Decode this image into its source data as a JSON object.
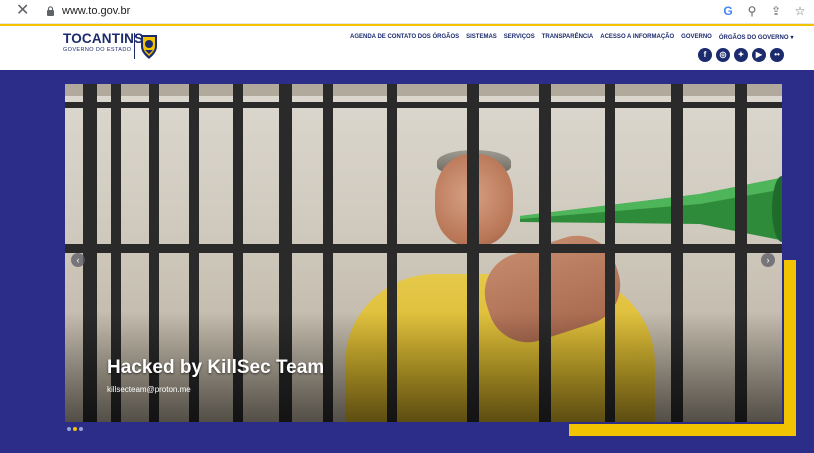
{
  "browser": {
    "url": "www.to.gov.br",
    "icons": [
      "close-icon",
      "lock-icon",
      "google-icon",
      "zoom-icon",
      "share-icon",
      "bookmark-star-icon"
    ]
  },
  "header": {
    "logo_name": "TOCANTINS",
    "logo_sub": "GOVERNO DO ESTADO",
    "nav": [
      "AGENDA DE CONTATO DOS ÓRGÃOS",
      "SISTEMAS",
      "SERVIÇOS",
      "TRANSPARÊNCIA",
      "ACESSO A INFORMAÇÃO",
      "GOVERNO",
      "ÓRGÃOS DO GOVERNO"
    ],
    "social": [
      "facebook-icon",
      "instagram-icon",
      "twitter-icon",
      "youtube-icon",
      "flickr-icon"
    ],
    "colors": {
      "brand": "#1c2b6e",
      "accent": "#f2c300"
    }
  },
  "hero": {
    "headline": "Hacked by KillSec Team",
    "email": "killsecteam@proton.me",
    "background": "#2c2d88",
    "slides_total": 3,
    "active_slide": 2
  }
}
